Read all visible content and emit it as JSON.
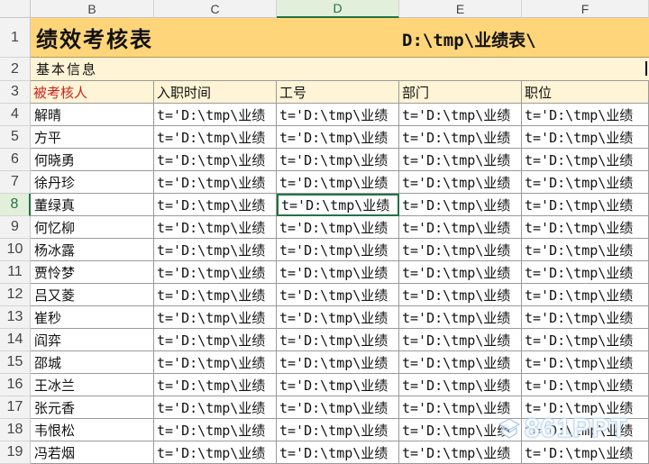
{
  "columns": [
    "B",
    "C",
    "D",
    "E",
    "F"
  ],
  "active_column": "D",
  "row_numbers": [
    "1",
    "2",
    "3",
    "4",
    "5",
    "6",
    "7",
    "8",
    "9",
    "10",
    "11",
    "12",
    "13",
    "14",
    "15",
    "16",
    "17",
    "18",
    "19"
  ],
  "active_row": "8",
  "title": "绩效考核表",
  "title_path": "D:\\tmp\\业绩表\\",
  "section_label": "基本信息",
  "table_headers": {
    "name": "被考核人",
    "hire_date": "入职时间",
    "employee_id": "工号",
    "department": "部门",
    "position": "职位"
  },
  "formula_text": "t='D:\\tmp\\业绩",
  "names": [
    "解晴",
    "方平",
    "何晓勇",
    "徐丹珍",
    "董绿真",
    "何忆柳",
    "杨冰露",
    "贾怜梦",
    "吕又菱",
    "崔秒",
    "阎弈",
    "邵城",
    "王冰兰",
    "张元香",
    "韦恨松",
    "冯若烟"
  ],
  "watermark": "861PPT",
  "colors": {
    "title_band": "#ffd57a",
    "info_band": "#fff4d6",
    "header_red": "#d02020",
    "selection": "#217346"
  }
}
